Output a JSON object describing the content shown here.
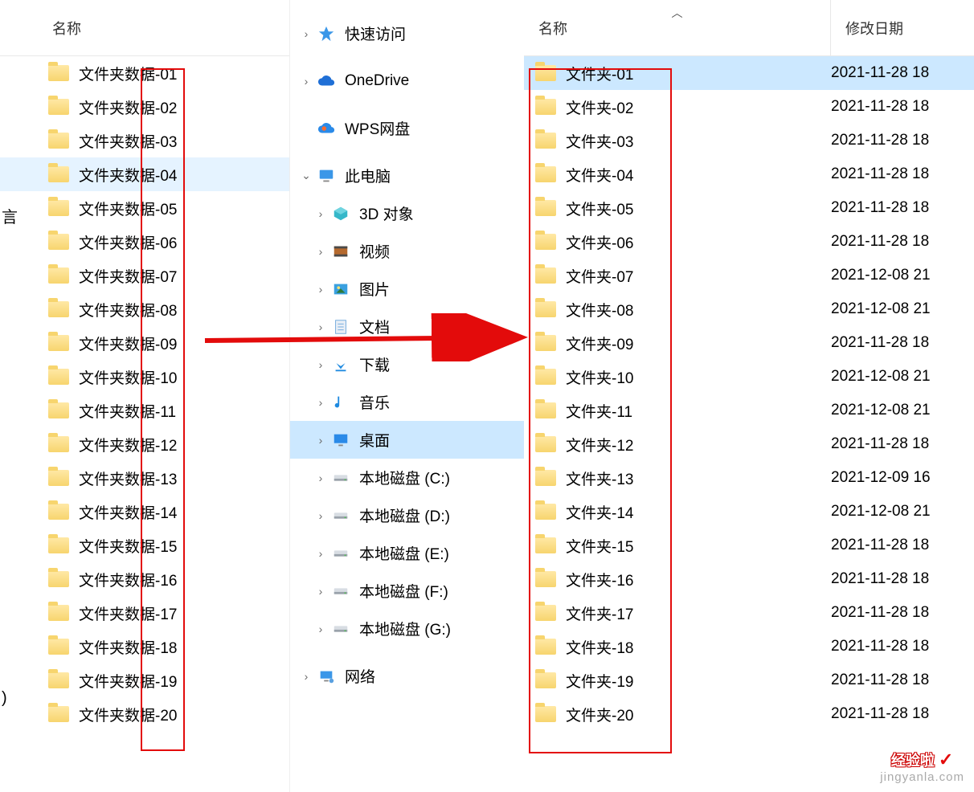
{
  "columns": {
    "name": "名称",
    "date": "修改日期"
  },
  "left_folders": [
    "文件夹数据-01",
    "文件夹数据-02",
    "文件夹数据-03",
    "文件夹数据-04",
    "文件夹数据-05",
    "文件夹数据-06",
    "文件夹数据-07",
    "文件夹数据-08",
    "文件夹数据-09",
    "文件夹数据-10",
    "文件夹数据-11",
    "文件夹数据-12",
    "文件夹数据-13",
    "文件夹数据-14",
    "文件夹数据-15",
    "文件夹数据-16",
    "文件夹数据-17",
    "文件夹数据-18",
    "文件夹数据-19",
    "文件夹数据-20"
  ],
  "left_selected_index": 3,
  "tree": {
    "quick_access": "快速访问",
    "onedrive": "OneDrive",
    "wps": "WPS网盘",
    "this_pc": "此电脑",
    "children": [
      {
        "label": "3D 对象",
        "icon": "3d"
      },
      {
        "label": "视频",
        "icon": "video"
      },
      {
        "label": "图片",
        "icon": "pictures"
      },
      {
        "label": "文档",
        "icon": "documents"
      },
      {
        "label": "下载",
        "icon": "downloads"
      },
      {
        "label": "音乐",
        "icon": "music"
      },
      {
        "label": "桌面",
        "icon": "desktop",
        "selected": true
      },
      {
        "label": "本地磁盘 (C:)",
        "icon": "disk"
      },
      {
        "label": "本地磁盘 (D:)",
        "icon": "disk"
      },
      {
        "label": "本地磁盘 (E:)",
        "icon": "disk"
      },
      {
        "label": "本地磁盘 (F:)",
        "icon": "disk"
      },
      {
        "label": "本地磁盘 (G:)",
        "icon": "disk"
      }
    ],
    "network": "网络"
  },
  "right_folders": [
    {
      "name": "文件夹-01",
      "date": "2021-11-28 18",
      "selected": true
    },
    {
      "name": "文件夹-02",
      "date": "2021-11-28 18"
    },
    {
      "name": "文件夹-03",
      "date": "2021-11-28 18"
    },
    {
      "name": "文件夹-04",
      "date": "2021-11-28 18"
    },
    {
      "name": "文件夹-05",
      "date": "2021-11-28 18"
    },
    {
      "name": "文件夹-06",
      "date": "2021-11-28 18"
    },
    {
      "name": "文件夹-07",
      "date": "2021-12-08 21"
    },
    {
      "name": "文件夹-08",
      "date": "2021-12-08 21"
    },
    {
      "name": "文件夹-09",
      "date": "2021-11-28 18"
    },
    {
      "name": "文件夹-10",
      "date": "2021-12-08 21"
    },
    {
      "name": "文件夹-11",
      "date": "2021-12-08 21"
    },
    {
      "name": "文件夹-12",
      "date": "2021-11-28 18"
    },
    {
      "name": "文件夹-13",
      "date": "2021-12-09 16"
    },
    {
      "name": "文件夹-14",
      "date": "2021-12-08 21"
    },
    {
      "name": "文件夹-15",
      "date": "2021-11-28 18"
    },
    {
      "name": "文件夹-16",
      "date": "2021-11-28 18"
    },
    {
      "name": "文件夹-17",
      "date": "2021-11-28 18"
    },
    {
      "name": "文件夹-18",
      "date": "2021-11-28 18"
    },
    {
      "name": "文件夹-19",
      "date": "2021-11-28 18"
    },
    {
      "name": "文件夹-20",
      "date": "2021-11-28 18"
    }
  ],
  "watermark": {
    "text": "经验啦",
    "check": "✓",
    "sub": "jingyanla.com"
  },
  "edge_glyphs": {
    "a": "言",
    "b": ")"
  }
}
